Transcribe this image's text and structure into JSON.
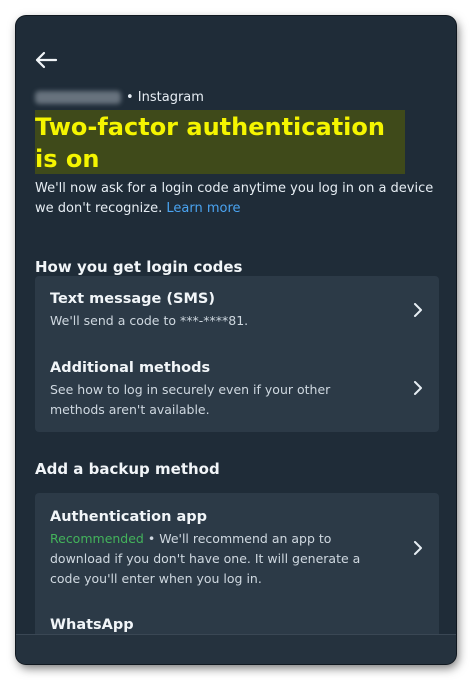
{
  "account": {
    "platform_label": "• Instagram"
  },
  "page": {
    "title": "Two-factor authentication is on",
    "description": "We'll now ask for a login code anytime you log in on a device we don't recognize.",
    "learn_more": "Learn more"
  },
  "login_codes": {
    "heading": "How you get login codes",
    "items": [
      {
        "title": "Text message (SMS)",
        "subtitle": "We'll send a code to ***-****81."
      },
      {
        "title": "Additional methods",
        "subtitle": "See how to log in securely even if your other methods aren't available."
      }
    ]
  },
  "backup": {
    "heading": "Add a backup method",
    "items": [
      {
        "title": "Authentication app",
        "badge": "Recommended",
        "subtitle": " • We'll recommend an app to download if you don't have one. It will generate a code you'll enter when you log in."
      },
      {
        "title": "WhatsApp"
      }
    ]
  },
  "colors": {
    "background": "#1f2c38",
    "card": "#2c3a47",
    "title_highlight": "#f5f500",
    "link": "#4aa3f0",
    "recommended": "#43b35b"
  },
  "icons": {
    "back": "arrow-left-icon",
    "chevron": "chevron-right-icon"
  }
}
